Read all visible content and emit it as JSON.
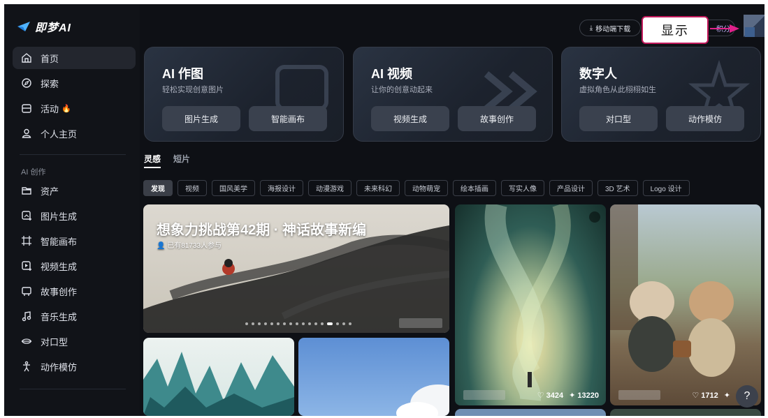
{
  "app": {
    "logo_text": "即梦AI"
  },
  "sidebar": {
    "items": [
      {
        "label": "首页",
        "icon": "home-icon",
        "active": true
      },
      {
        "label": "探索",
        "icon": "compass-icon"
      },
      {
        "label": "活动",
        "icon": "gift-icon",
        "badge": "🔥"
      },
      {
        "label": "个人主页",
        "icon": "user-icon"
      }
    ],
    "section_label": "AI 创作",
    "create_items": [
      {
        "label": "资产",
        "icon": "folder-icon"
      },
      {
        "label": "图片生成",
        "icon": "image-gen-icon"
      },
      {
        "label": "智能画布",
        "icon": "canvas-icon"
      },
      {
        "label": "视频生成",
        "icon": "video-gen-icon"
      },
      {
        "label": "故事创作",
        "icon": "story-icon"
      },
      {
        "label": "音乐生成",
        "icon": "music-icon"
      },
      {
        "label": "对口型",
        "icon": "lipsync-icon"
      },
      {
        "label": "动作模仿",
        "icon": "motion-icon"
      }
    ]
  },
  "topbar": {
    "download_label": "移动端下载",
    "points_label": "积分",
    "tooltip_label": "显示"
  },
  "cards": [
    {
      "title": "AI 作图",
      "subtitle": "轻松实现创意图片",
      "buttons": [
        "图片生成",
        "智能画布"
      ]
    },
    {
      "title": "AI 视频",
      "subtitle": "让你的创意动起来",
      "buttons": [
        "视频生成",
        "故事创作"
      ]
    },
    {
      "title": "数字人",
      "subtitle": "虚拟角色从此栩栩如生",
      "buttons": [
        "对口型",
        "动作模仿"
      ]
    }
  ],
  "tabs": [
    "灵感",
    "短片"
  ],
  "chips": [
    "发现",
    "视频",
    "国风美学",
    "海报设计",
    "动漫游戏",
    "未来科幻",
    "动物萌宠",
    "绘本插画",
    "写实人像",
    "产品设计",
    "3D 艺术",
    "Logo 设计"
  ],
  "banner": {
    "title": "想象力挑战第42期 · 神话故事新编",
    "participants": "已有81733人参与"
  },
  "tiles": [
    {
      "likes": "3424",
      "remakes": "13220"
    },
    {
      "likes": "1712",
      "remakes": ""
    }
  ],
  "help_label": "?",
  "colors": {
    "accent": "#e0218a",
    "background": "#0e1015",
    "sidebar": "#111318"
  }
}
